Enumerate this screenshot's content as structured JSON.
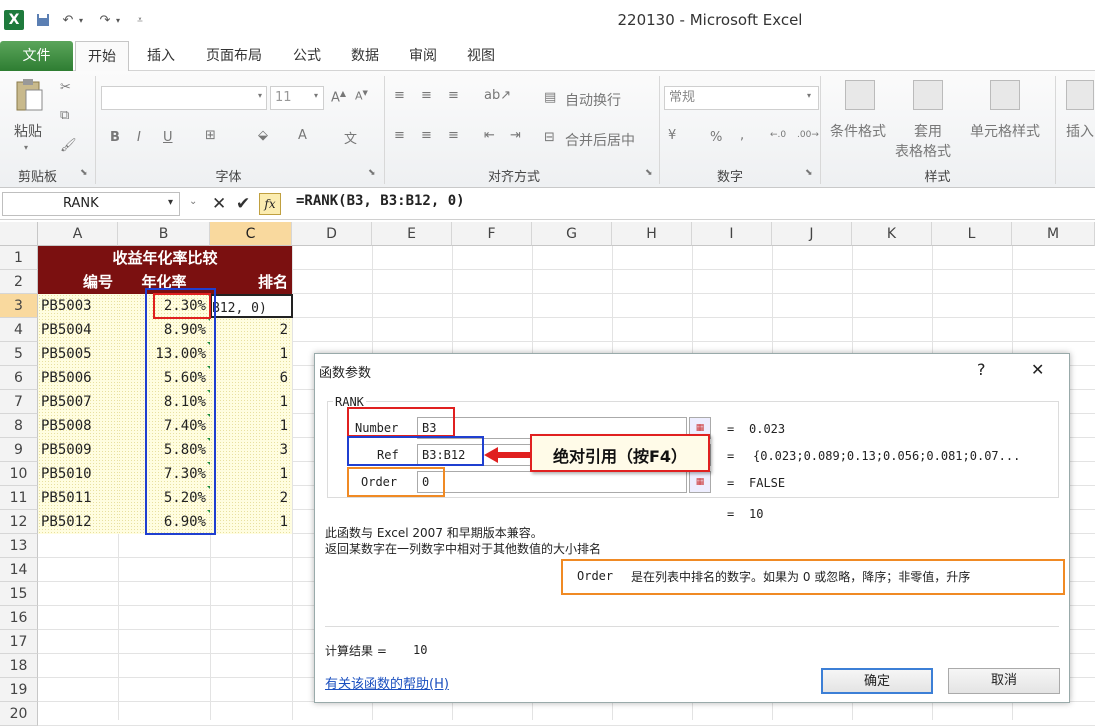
{
  "window": {
    "title": "220130 - Microsoft Excel"
  },
  "tabs": [
    "文件",
    "开始",
    "插入",
    "页面布局",
    "公式",
    "数据",
    "审阅",
    "视图"
  ],
  "ribbon": {
    "clipboard": {
      "paste": "粘贴",
      "label": "剪贴板"
    },
    "font": {
      "name": "",
      "size": "11",
      "label": "字体",
      "bold": "B",
      "italic": "I",
      "underline": "U"
    },
    "alignment": {
      "wrap": "自动换行",
      "merge": "合并后居中",
      "label": "对齐方式"
    },
    "number": {
      "format": "常规",
      "percent": "%",
      "comma": ",",
      "label": "数字"
    },
    "styles": {
      "cond": "条件格式",
      "table_top": "套用",
      "table_bottom": "表格格式",
      "cell": "单元格样式",
      "label": "样式"
    },
    "cells": {
      "insert": "插入"
    }
  },
  "formula_bar": {
    "name_box": "RANK",
    "fx": "fx",
    "formula": "=RANK(B3, B3:B12, 0)"
  },
  "columns": [
    "A",
    "B",
    "C",
    "D",
    "E",
    "F",
    "G",
    "H",
    "I",
    "J",
    "K",
    "L",
    "M"
  ],
  "rows": [
    "1",
    "2",
    "3",
    "4",
    "5",
    "6",
    "7",
    "8",
    "9",
    "10",
    "11",
    "12",
    "13",
    "14",
    "15",
    "16",
    "17",
    "18",
    "19",
    "20"
  ],
  "sheet": {
    "title": "收益年化率比较",
    "headers": [
      "编号",
      "年化率",
      "排名"
    ],
    "editing_cell": "B12, 0)",
    "data": [
      {
        "id": "PB5003",
        "rate": "2.30%",
        "rank": ""
      },
      {
        "id": "PB5004",
        "rate": "8.90%",
        "rank": "2"
      },
      {
        "id": "PB5005",
        "rate": "13.00%",
        "rank": "1"
      },
      {
        "id": "PB5006",
        "rate": "5.60%",
        "rank": "6"
      },
      {
        "id": "PB5007",
        "rate": "8.10%",
        "rank": "1"
      },
      {
        "id": "PB5008",
        "rate": "7.40%",
        "rank": "1"
      },
      {
        "id": "PB5009",
        "rate": "5.80%",
        "rank": "3"
      },
      {
        "id": "PB5010",
        "rate": "7.30%",
        "rank": "1"
      },
      {
        "id": "PB5011",
        "rate": "5.20%",
        "rank": "2"
      },
      {
        "id": "PB5012",
        "rate": "6.90%",
        "rank": "1"
      }
    ]
  },
  "dialog": {
    "title": "函数参数",
    "help_glyph": "?",
    "close_glyph": "✕",
    "func": "RANK",
    "args": [
      {
        "name": "Number",
        "value": "B3",
        "result": "0.023"
      },
      {
        "name": "Ref",
        "value": "B3:B12",
        "result": "{0.023;0.089;0.13;0.056;0.081;0.07..."
      },
      {
        "name": "Order",
        "value": "0",
        "result": "FALSE"
      }
    ],
    "eq": "=",
    "overall_result": "10",
    "compat": "此函数与 Excel 2007 和早期版本兼容。",
    "desc": "返回某数字在一列数字中相对于其他数值的大小排名",
    "arg_help_name": "Order",
    "arg_help_text": "是在列表中排名的数字。如果为 0 或忽略，降序；非零值，升序",
    "calc_label": "计算结果 =",
    "calc_value": "10",
    "help_link": "有关该函数的帮助(H)",
    "ok": "确定",
    "cancel": "取消"
  },
  "annotation": {
    "text": "绝对引用（按F4）"
  },
  "colors": {
    "header_bg": "#7b1010",
    "red": "#e02020",
    "blue": "#1f3fd0",
    "orange": "#f08a24",
    "excel_green": "#2e7d32"
  }
}
